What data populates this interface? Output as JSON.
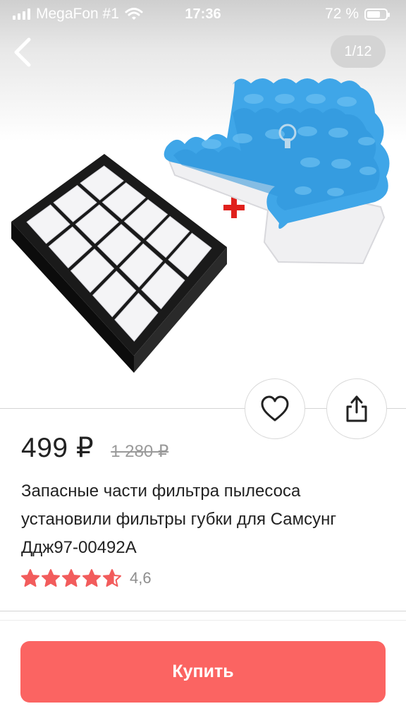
{
  "status_bar": {
    "carrier": "MegaFon #1",
    "time": "17:36",
    "battery": "72 %",
    "battery_level": 0.72
  },
  "gallery": {
    "counter": "1/12",
    "back_icon": "chevron-left-icon"
  },
  "actions": {
    "like_icon": "heart-icon",
    "share_icon": "share-icon"
  },
  "product": {
    "price": "499 ₽",
    "old_price": "1 280 ₽",
    "title": "Запасные части фильтра пылесоса установили фильтры губки для Самсунг Ддж97-00492A",
    "rating": 4.6,
    "rating_text": "4,6",
    "star_color": "#f25c5c"
  },
  "buy": {
    "label": "Купить",
    "color": "#fb6462"
  }
}
